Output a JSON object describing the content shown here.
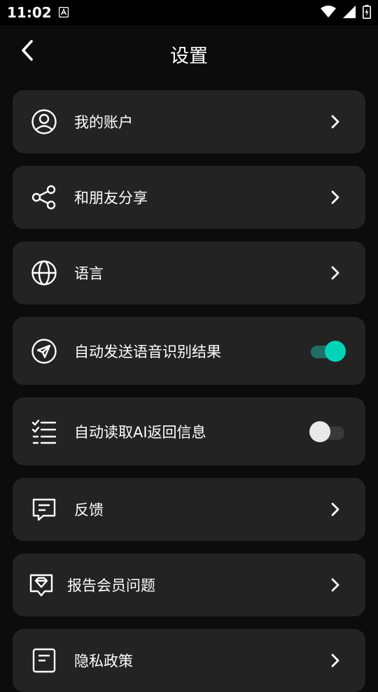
{
  "status_bar": {
    "time": "11:02"
  },
  "header": {
    "title": "设置"
  },
  "items": [
    {
      "label": "我的账户",
      "icon": "user-circle-icon"
    },
    {
      "label": "和朋友分享",
      "icon": "share-icon"
    },
    {
      "label": "语言",
      "icon": "globe-icon"
    },
    {
      "label": "自动发送语音识别结果",
      "icon": "send-icon",
      "toggle": true
    },
    {
      "label": "自动读取AI返回信息",
      "icon": "checklist-icon",
      "toggle": false
    },
    {
      "label": "反馈",
      "icon": "message-icon"
    },
    {
      "label": "报告会员问题",
      "icon": "diamond-icon"
    },
    {
      "label": "隐私政策",
      "icon": "document-icon"
    }
  ],
  "colors": {
    "background": "#0c0c0c",
    "card": "#232323",
    "accent": "#00d4b8"
  }
}
